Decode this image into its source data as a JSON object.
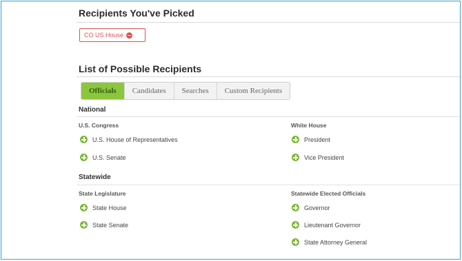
{
  "picked": {
    "title": "Recipients You've Picked",
    "chips": [
      {
        "label": "CO US House"
      }
    ]
  },
  "possible": {
    "title": "List of Possible Recipients",
    "tabs": [
      "Officials",
      "Candidates",
      "Searches",
      "Custom Recipients"
    ],
    "active_tab": "Officials",
    "sections": [
      {
        "title": "National",
        "groups": [
          {
            "title": "U.S. Congress",
            "items": [
              "U.S. House of Representatives",
              "U.S. Senate"
            ]
          },
          {
            "title": "White House",
            "items": [
              "President",
              "Vice President"
            ]
          }
        ]
      },
      {
        "title": "Statewide",
        "groups": [
          {
            "title": "State Legislature",
            "items": [
              "State House",
              "State Senate"
            ]
          },
          {
            "title": "Statewide Elected Officials",
            "items": [
              "Governor",
              "Lieutenant Governor",
              "State Attorney General"
            ]
          }
        ]
      }
    ]
  },
  "colors": {
    "frame": "#3aa3c8",
    "remove": "#d9534f",
    "tab_active": "#8cc63f",
    "add_icon": "#7db83a"
  }
}
